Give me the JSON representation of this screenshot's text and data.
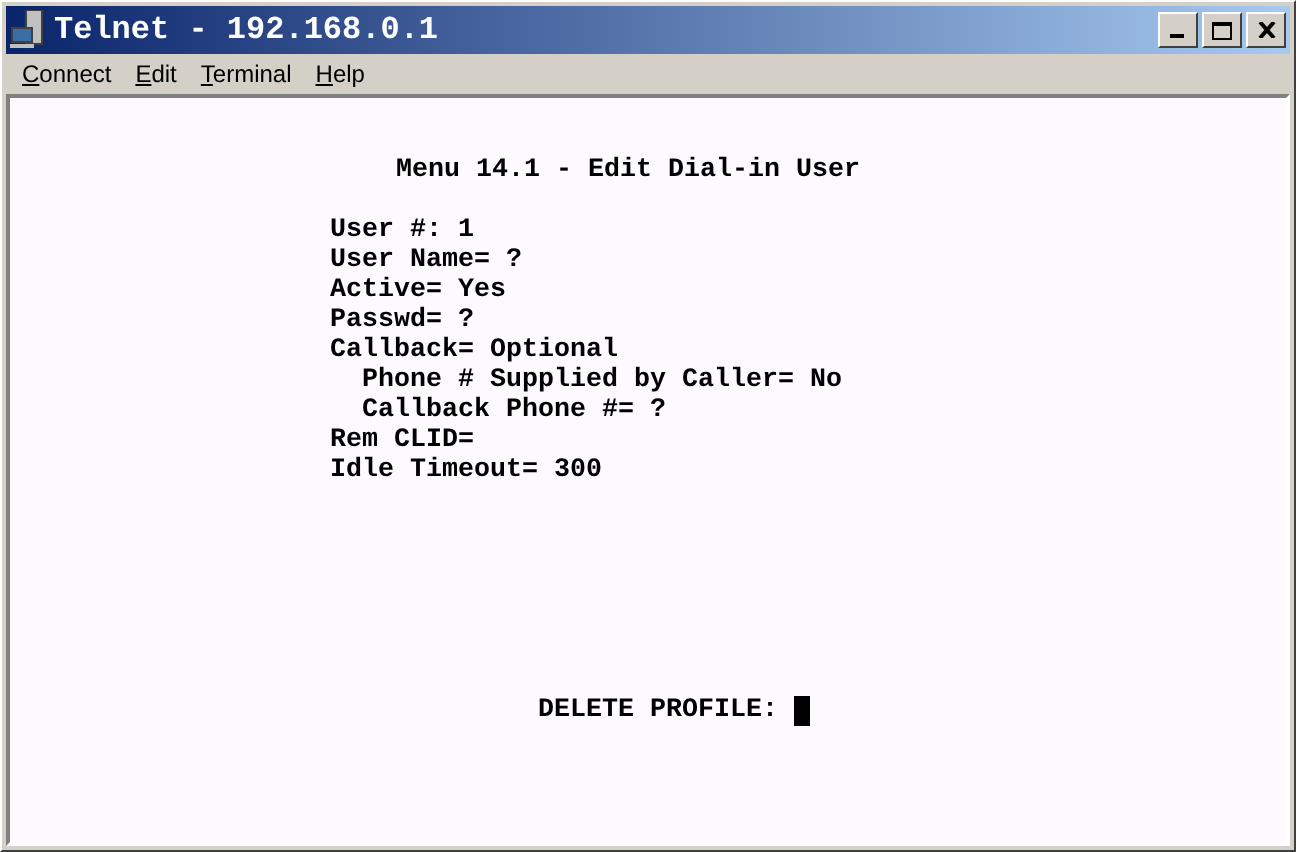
{
  "window": {
    "title": "Telnet - 192.168.0.1"
  },
  "menu": [
    {
      "label": "Connect"
    },
    {
      "label": "Edit"
    },
    {
      "label": "Terminal"
    },
    {
      "label": "Help"
    }
  ],
  "terminal": {
    "heading": "Menu 14.1 - Edit Dial-in User",
    "fields": [
      {
        "text": "User #: 1"
      },
      {
        "text": "User Name= ?"
      },
      {
        "text": "Active= Yes"
      },
      {
        "text": "Passwd= ?"
      },
      {
        "text": "Callback= Optional",
        "children": [
          {
            "text": "Phone # Supplied by Caller= No"
          },
          {
            "text": "Callback Phone #= ?"
          }
        ]
      },
      {
        "text": "Rem CLID="
      },
      {
        "text": "Idle Timeout= 300"
      }
    ],
    "prompt": "DELETE PROFILE:"
  }
}
